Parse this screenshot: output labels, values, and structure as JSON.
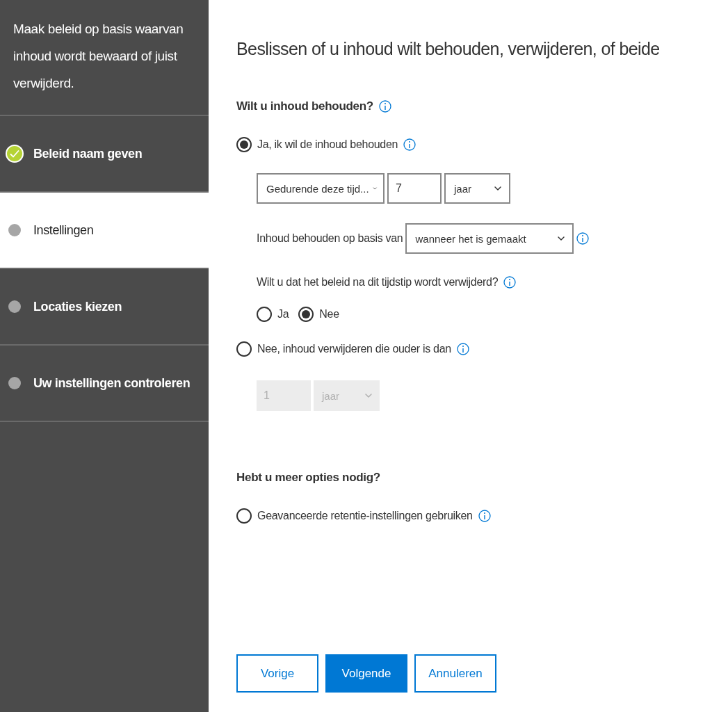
{
  "sidebar": {
    "description": "Maak beleid op basis waarvan inhoud wordt bewaard of juist verwijderd.",
    "steps": [
      {
        "label": "Beleid naam geven",
        "completed": true,
        "selected": false
      },
      {
        "label": "Instellingen",
        "completed": false,
        "selected": true
      },
      {
        "label": "Locaties kiezen",
        "completed": false,
        "selected": false
      },
      {
        "label": "Uw instellingen controleren",
        "completed": false,
        "selected": false
      }
    ]
  },
  "main": {
    "title": "Beslissen of u inhoud wilt behouden, verwijderen, of beide",
    "retain": {
      "heading": "Wilt u inhoud behouden?",
      "keep_choice": {
        "label": "Ja, ik wil de inhoud behouden",
        "selected": true
      },
      "retain_period": {
        "mode": "Gedurende deze tijd...",
        "amount": "7",
        "unit": "jaar"
      },
      "basis": {
        "label": "Inhoud behouden op basis van",
        "value": "wanneer het is gemaakt"
      },
      "delete_after": {
        "question": "Wilt u dat het beleid na dit tijdstip wordt verwijderd?",
        "choices": [
          {
            "label": "Ja",
            "selected": false
          },
          {
            "label": "Nee",
            "selected": true
          }
        ]
      },
      "delete_choice": {
        "label": "Nee, inhoud verwijderen die ouder is dan",
        "selected": false
      },
      "delete_period": {
        "amount": "1",
        "unit": "jaar",
        "disabled": true
      }
    },
    "advanced": {
      "heading": "Hebt u meer opties nodig?",
      "choice": {
        "label": "Geavanceerde retentie-instellingen gebruiken",
        "selected": false
      }
    },
    "buttons": [
      {
        "label": "Vorige",
        "kind": "secondary"
      },
      {
        "label": "Volgende",
        "kind": "primary"
      },
      {
        "label": "Annuleren",
        "kind": "secondary"
      }
    ]
  }
}
